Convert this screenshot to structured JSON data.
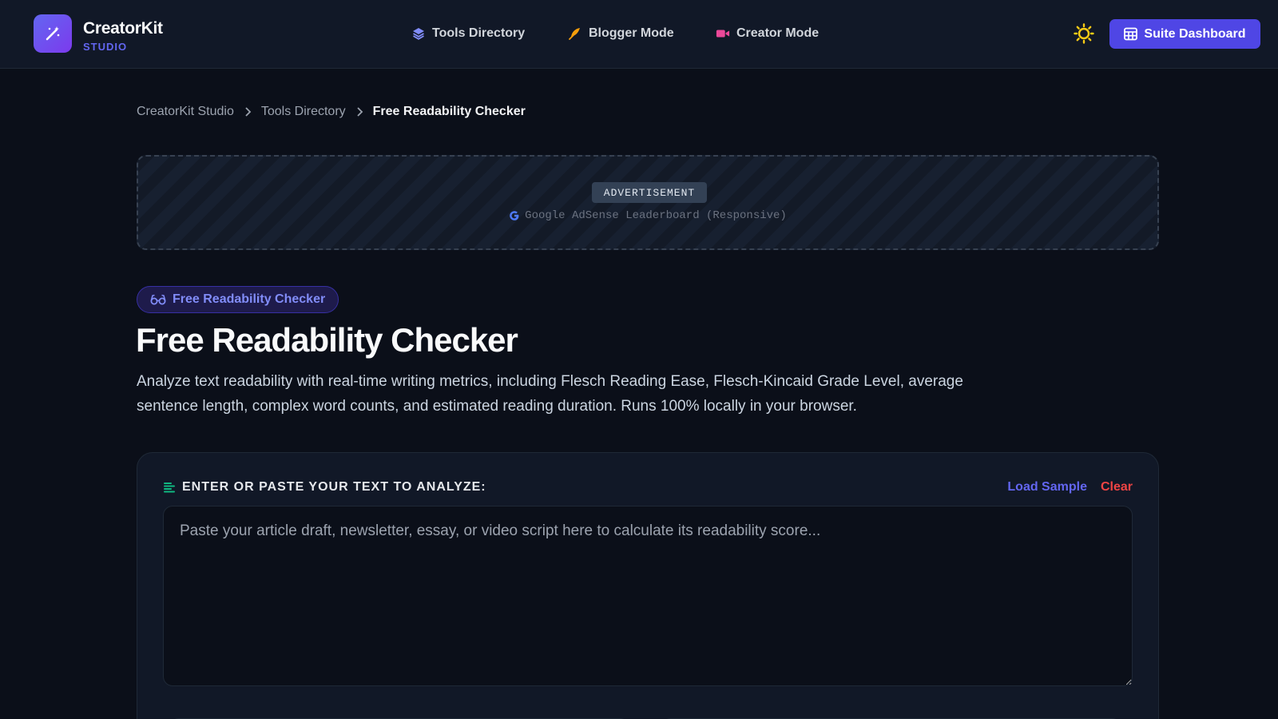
{
  "header": {
    "brand_name": "CreatorKit",
    "brand_sub": "STUDIO",
    "nav": [
      {
        "label": "Tools Directory",
        "icon": "layers-icon",
        "color": "#818cf8"
      },
      {
        "label": "Blogger Mode",
        "icon": "feather-icon",
        "color": "#f59e0b"
      },
      {
        "label": "Creator Mode",
        "icon": "video-icon",
        "color": "#ec4899"
      }
    ],
    "theme_icon": "sun-icon",
    "suite_button": "Suite Dashboard"
  },
  "breadcrumb": {
    "items": [
      "CreatorKit Studio",
      "Tools Directory"
    ],
    "current": "Free Readability Checker"
  },
  "ad": {
    "label": "ADVERTISEMENT",
    "text": "Google AdSense Leaderboard (Responsive)"
  },
  "hero": {
    "badge": "Free Readability Checker",
    "title": "Free Readability Checker",
    "description": "Analyze text readability with real-time writing metrics, including Flesch Reading Ease, Flesch-Kincaid Grade Level, average sentence length, complex word counts, and estimated reading duration. Runs 100% locally in your browser."
  },
  "editor": {
    "heading": "ENTER OR PASTE YOUR TEXT TO ANALYZE:",
    "load_sample": "Load Sample",
    "clear": "Clear",
    "placeholder": "Paste your article draft, newsletter, essay, or video script here to calculate its readability score...",
    "value": ""
  },
  "colors": {
    "accent": "#4f46e5",
    "brand_sub": "#6366f1",
    "danger": "#ef4444",
    "background": "#0b0f19"
  }
}
